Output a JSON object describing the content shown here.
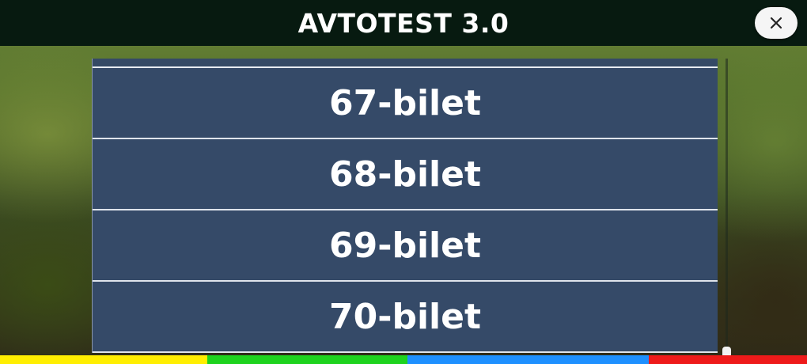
{
  "header": {
    "title": "AVTOTEST 3.0",
    "close_symbol": "×"
  },
  "tickets": [
    {
      "label": "67-bilet"
    },
    {
      "label": "68-bilet"
    },
    {
      "label": "69-bilet"
    },
    {
      "label": "70-bilet"
    }
  ],
  "bottom_bar": {
    "colors": [
      "#ffee00",
      "#1ed31e",
      "#1e90ff",
      "#ee1a1a"
    ]
  },
  "theme": {
    "header_bg": "#071a10",
    "item_bg": "#354a68",
    "item_text": "#ffffff"
  }
}
